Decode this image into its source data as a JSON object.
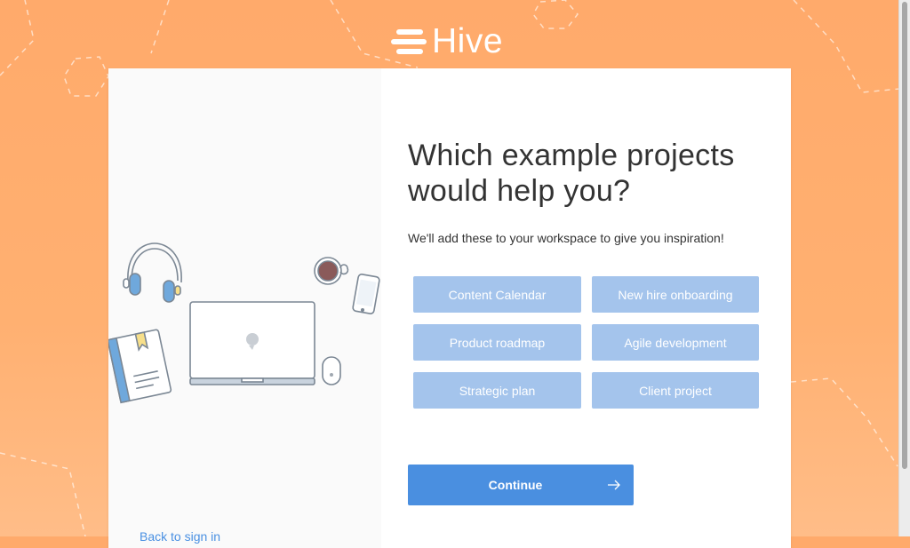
{
  "brand": {
    "name": "Hive",
    "text_color": "#ffffff",
    "background_color": "#ffad6e"
  },
  "onboarding": {
    "title": "Which example projects would help you?",
    "subtitle": "We'll add these to your workspace to give you inspiration!",
    "options": [
      {
        "label": "Content Calendar",
        "selected": false
      },
      {
        "label": "New hire onboarding",
        "selected": false
      },
      {
        "label": "Product roadmap",
        "selected": false
      },
      {
        "label": "Agile development",
        "selected": false
      },
      {
        "label": "Strategic plan",
        "selected": false
      },
      {
        "label": "Client project",
        "selected": false
      }
    ],
    "option_color": "#a4c4ec",
    "continue_label": "Continue",
    "continue_color": "#4a8fe0",
    "back_link_label": "Back to sign in",
    "illustration_icons": [
      "headphones-icon",
      "coffee-cup-icon",
      "phone-icon",
      "laptop-icon",
      "mouse-icon",
      "notebook-icon"
    ],
    "continue_icon": "arrow-right-icon"
  }
}
